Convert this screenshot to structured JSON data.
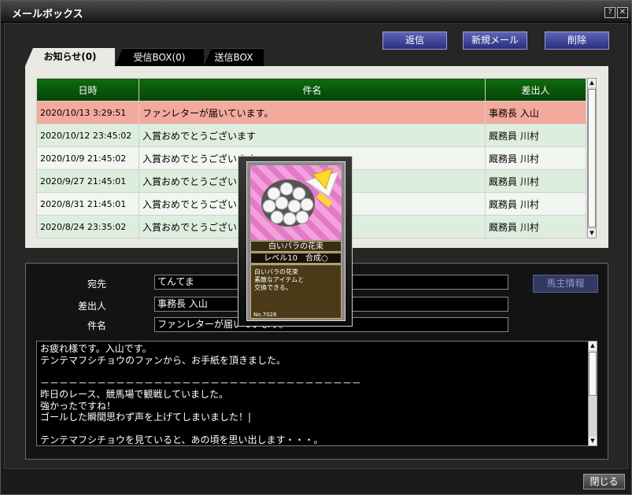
{
  "window": {
    "title": "メールボックス",
    "help_label": "?",
    "close_label": "✕"
  },
  "toolbar": {
    "reply_label": "返信",
    "new_mail_label": "新規メール",
    "delete_label": "削除"
  },
  "tabs": [
    {
      "label": "お知らせ(0)",
      "active": true
    },
    {
      "label": "受信BOX(0)",
      "active": false
    },
    {
      "label": "送信BOX",
      "active": false
    }
  ],
  "mail_list": {
    "columns": [
      "日時",
      "件名",
      "差出人"
    ],
    "rows": [
      {
        "date": "2020/10/13 3:29:51",
        "subject": "ファンレターが届いています。",
        "sender": "事務長 入山",
        "selected": true
      },
      {
        "date": "2020/10/12 23:45:02",
        "subject": "入賞おめでとうございます",
        "sender": "厩務員 川村"
      },
      {
        "date": "2020/10/9 21:45:02",
        "subject": "入賞おめでとうございます",
        "sender": "厩務員 川村"
      },
      {
        "date": "2020/9/27 21:45:01",
        "subject": "入賞おめでとうございます",
        "sender": "厩務員 川村"
      },
      {
        "date": "2020/8/31 21:45:01",
        "subject": "入賞おめでとうございます",
        "sender": "厩務員 川村"
      },
      {
        "date": "2020/8/24 23:35:02",
        "subject": "入賞おめでとうございます",
        "sender": "厩務員 川村"
      }
    ]
  },
  "detail": {
    "to_label": "宛先",
    "to_value": "てんてま",
    "from_label": "差出人",
    "from_value": "事務長 入山",
    "subject_label": "件名",
    "subject_value": "ファンレターが届いています。",
    "owner_info_label": "馬主情報",
    "body": "お疲れ様です。入山です。\nテンテマフシチョウのファンから、お手紙を頂きました。\n\n－－－－－－－－－－－－－－－－－－－－－－－－－－－－－－－－－－\n昨日のレース、競馬場で観戦していました。\n強かったですね！\nゴールした瞬間思わず声を上げてしまいました！|\n\nテンテマフシチョウを見ていると、あの頃を思い出します・・・。"
  },
  "card": {
    "name": "白いバラの花束",
    "level": "レベル10　合成○",
    "description": "白いバラの花束\n素敵なアイテムと\n交換できる。",
    "number": "No.7026"
  },
  "footer": {
    "close_label": "閉じる"
  }
}
